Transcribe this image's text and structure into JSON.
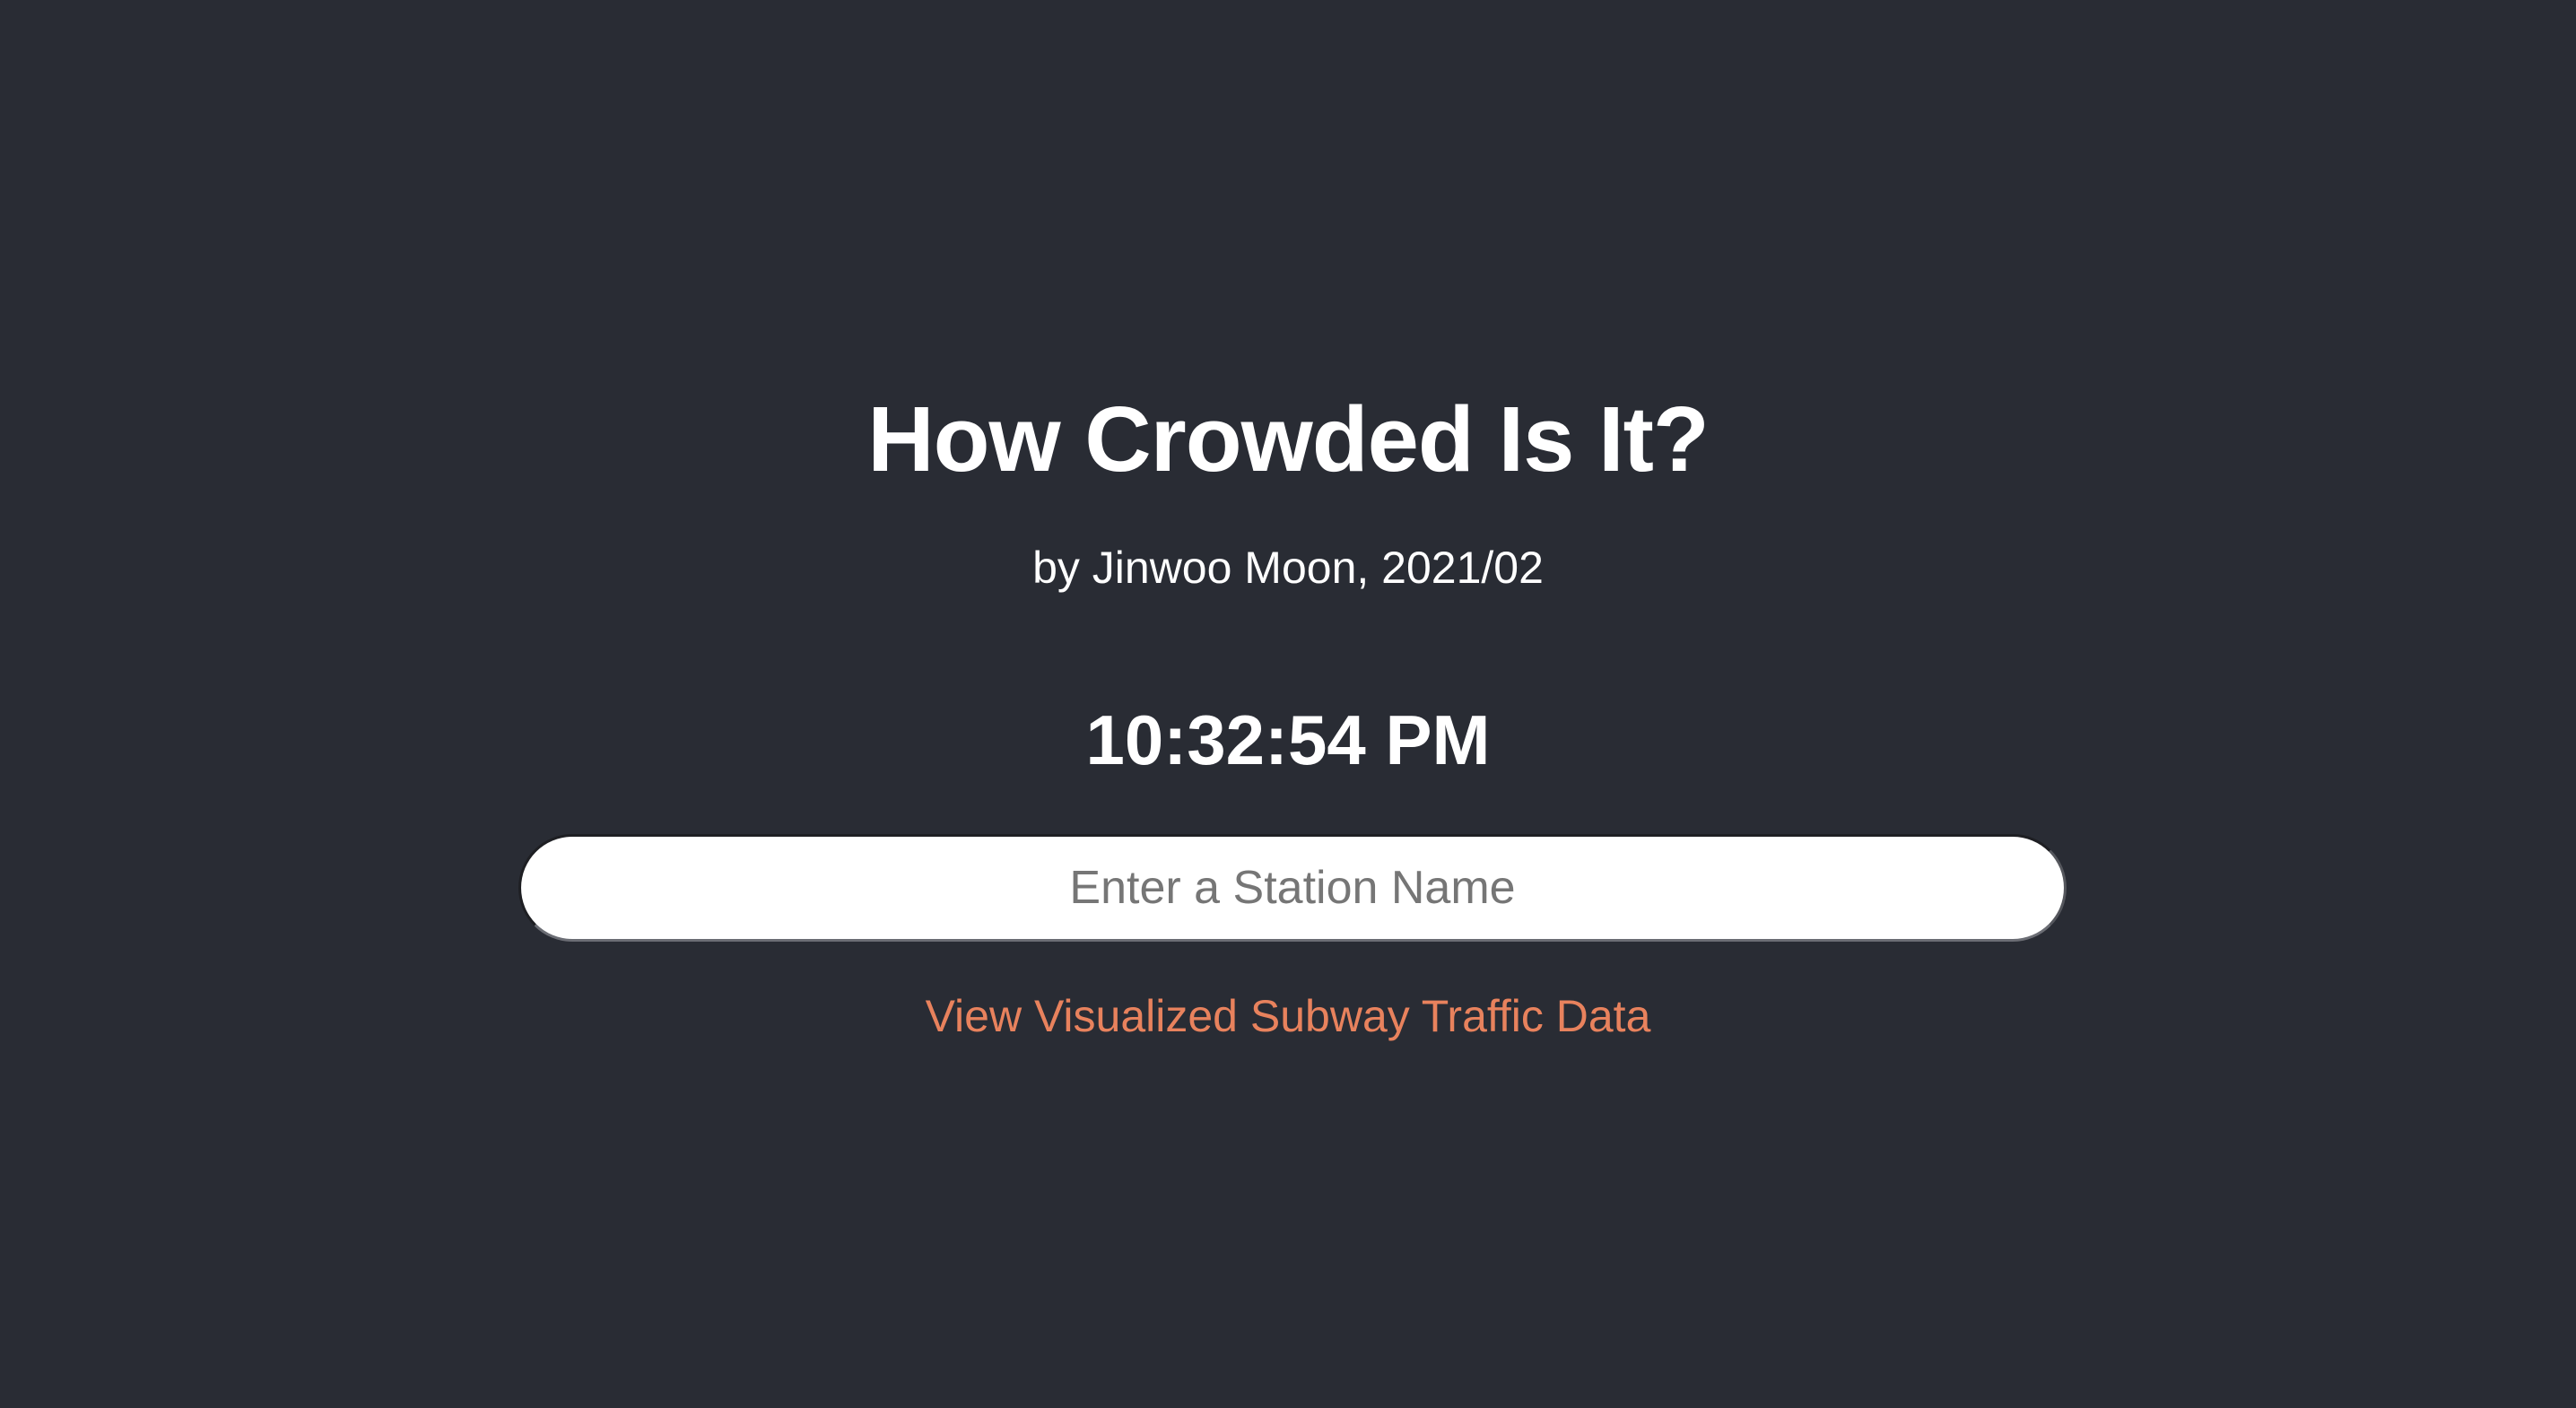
{
  "page": {
    "title": "How Crowded Is It?",
    "byline": "by Jinwoo Moon, 2021/02",
    "clock": "10:32:54 PM"
  },
  "search": {
    "value": "",
    "placeholder": "Enter a Station Name"
  },
  "link": {
    "label": "View Visualized Subway Traffic Data"
  },
  "colors": {
    "background": "#292c34",
    "text": "#ffffff",
    "accent": "#e8825d",
    "input_background": "#ffffff",
    "placeholder": "#767676"
  }
}
